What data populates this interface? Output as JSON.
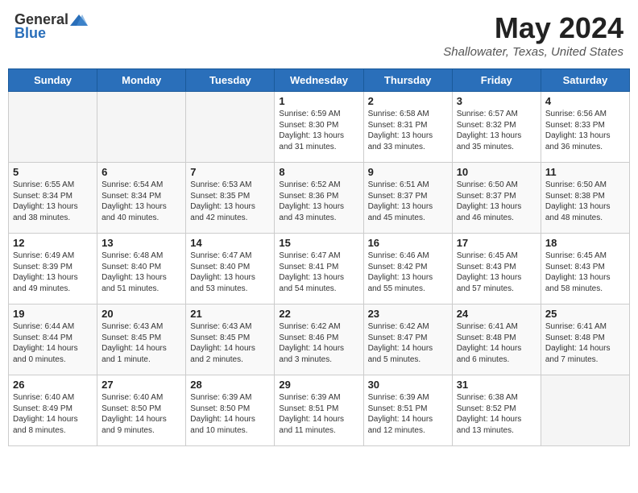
{
  "header": {
    "logo_general": "General",
    "logo_blue": "Blue",
    "month_year": "May 2024",
    "location": "Shallowater, Texas, United States"
  },
  "weekdays": [
    "Sunday",
    "Monday",
    "Tuesday",
    "Wednesday",
    "Thursday",
    "Friday",
    "Saturday"
  ],
  "weeks": [
    [
      {
        "day": "",
        "info": ""
      },
      {
        "day": "",
        "info": ""
      },
      {
        "day": "",
        "info": ""
      },
      {
        "day": "1",
        "info": "Sunrise: 6:59 AM\nSunset: 8:30 PM\nDaylight: 13 hours\nand 31 minutes."
      },
      {
        "day": "2",
        "info": "Sunrise: 6:58 AM\nSunset: 8:31 PM\nDaylight: 13 hours\nand 33 minutes."
      },
      {
        "day": "3",
        "info": "Sunrise: 6:57 AM\nSunset: 8:32 PM\nDaylight: 13 hours\nand 35 minutes."
      },
      {
        "day": "4",
        "info": "Sunrise: 6:56 AM\nSunset: 8:33 PM\nDaylight: 13 hours\nand 36 minutes."
      }
    ],
    [
      {
        "day": "5",
        "info": "Sunrise: 6:55 AM\nSunset: 8:34 PM\nDaylight: 13 hours\nand 38 minutes."
      },
      {
        "day": "6",
        "info": "Sunrise: 6:54 AM\nSunset: 8:34 PM\nDaylight: 13 hours\nand 40 minutes."
      },
      {
        "day": "7",
        "info": "Sunrise: 6:53 AM\nSunset: 8:35 PM\nDaylight: 13 hours\nand 42 minutes."
      },
      {
        "day": "8",
        "info": "Sunrise: 6:52 AM\nSunset: 8:36 PM\nDaylight: 13 hours\nand 43 minutes."
      },
      {
        "day": "9",
        "info": "Sunrise: 6:51 AM\nSunset: 8:37 PM\nDaylight: 13 hours\nand 45 minutes."
      },
      {
        "day": "10",
        "info": "Sunrise: 6:50 AM\nSunset: 8:37 PM\nDaylight: 13 hours\nand 46 minutes."
      },
      {
        "day": "11",
        "info": "Sunrise: 6:50 AM\nSunset: 8:38 PM\nDaylight: 13 hours\nand 48 minutes."
      }
    ],
    [
      {
        "day": "12",
        "info": "Sunrise: 6:49 AM\nSunset: 8:39 PM\nDaylight: 13 hours\nand 49 minutes."
      },
      {
        "day": "13",
        "info": "Sunrise: 6:48 AM\nSunset: 8:40 PM\nDaylight: 13 hours\nand 51 minutes."
      },
      {
        "day": "14",
        "info": "Sunrise: 6:47 AM\nSunset: 8:40 PM\nDaylight: 13 hours\nand 53 minutes."
      },
      {
        "day": "15",
        "info": "Sunrise: 6:47 AM\nSunset: 8:41 PM\nDaylight: 13 hours\nand 54 minutes."
      },
      {
        "day": "16",
        "info": "Sunrise: 6:46 AM\nSunset: 8:42 PM\nDaylight: 13 hours\nand 55 minutes."
      },
      {
        "day": "17",
        "info": "Sunrise: 6:45 AM\nSunset: 8:43 PM\nDaylight: 13 hours\nand 57 minutes."
      },
      {
        "day": "18",
        "info": "Sunrise: 6:45 AM\nSunset: 8:43 PM\nDaylight: 13 hours\nand 58 minutes."
      }
    ],
    [
      {
        "day": "19",
        "info": "Sunrise: 6:44 AM\nSunset: 8:44 PM\nDaylight: 14 hours\nand 0 minutes."
      },
      {
        "day": "20",
        "info": "Sunrise: 6:43 AM\nSunset: 8:45 PM\nDaylight: 14 hours\nand 1 minute."
      },
      {
        "day": "21",
        "info": "Sunrise: 6:43 AM\nSunset: 8:45 PM\nDaylight: 14 hours\nand 2 minutes."
      },
      {
        "day": "22",
        "info": "Sunrise: 6:42 AM\nSunset: 8:46 PM\nDaylight: 14 hours\nand 3 minutes."
      },
      {
        "day": "23",
        "info": "Sunrise: 6:42 AM\nSunset: 8:47 PM\nDaylight: 14 hours\nand 5 minutes."
      },
      {
        "day": "24",
        "info": "Sunrise: 6:41 AM\nSunset: 8:48 PM\nDaylight: 14 hours\nand 6 minutes."
      },
      {
        "day": "25",
        "info": "Sunrise: 6:41 AM\nSunset: 8:48 PM\nDaylight: 14 hours\nand 7 minutes."
      }
    ],
    [
      {
        "day": "26",
        "info": "Sunrise: 6:40 AM\nSunset: 8:49 PM\nDaylight: 14 hours\nand 8 minutes."
      },
      {
        "day": "27",
        "info": "Sunrise: 6:40 AM\nSunset: 8:50 PM\nDaylight: 14 hours\nand 9 minutes."
      },
      {
        "day": "28",
        "info": "Sunrise: 6:39 AM\nSunset: 8:50 PM\nDaylight: 14 hours\nand 10 minutes."
      },
      {
        "day": "29",
        "info": "Sunrise: 6:39 AM\nSunset: 8:51 PM\nDaylight: 14 hours\nand 11 minutes."
      },
      {
        "day": "30",
        "info": "Sunrise: 6:39 AM\nSunset: 8:51 PM\nDaylight: 14 hours\nand 12 minutes."
      },
      {
        "day": "31",
        "info": "Sunrise: 6:38 AM\nSunset: 8:52 PM\nDaylight: 14 hours\nand 13 minutes."
      },
      {
        "day": "",
        "info": ""
      }
    ]
  ]
}
